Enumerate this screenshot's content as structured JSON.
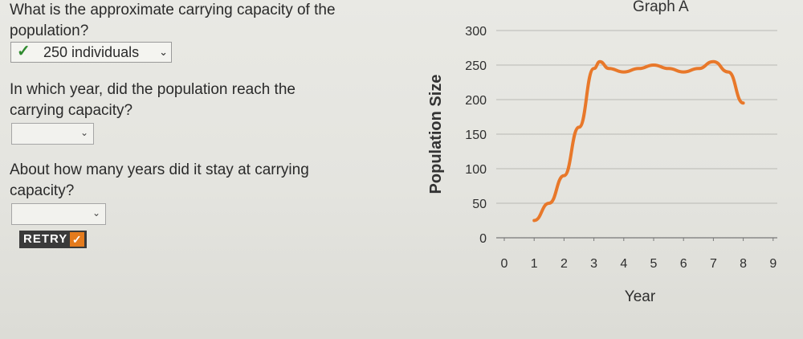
{
  "questions": {
    "q1": "What is the approximate carrying capacity of the population?",
    "q1_answer": "250 individuals",
    "q2": "In which year, did the population reach the carrying capacity?",
    "q3": "About how many years did it stay at carrying capacity?"
  },
  "retry_label": "RETRY",
  "icons": {
    "answer_check": "check-icon",
    "retry_check": "check-icon",
    "dropdown": "chevron-down-icon"
  },
  "colors": {
    "line": "#e8782a",
    "correct": "#2f8a2f",
    "retry_badge": "#e47b1d"
  },
  "chart_data": {
    "type": "line",
    "title": "Graph A",
    "xlabel": "Year",
    "ylabel": "Population Size",
    "x_ticks": [
      0,
      1,
      2,
      3,
      4,
      5,
      6,
      7,
      8,
      9
    ],
    "y_ticks": [
      0,
      50,
      100,
      150,
      200,
      250,
      300
    ],
    "xlim": [
      0,
      9
    ],
    "ylim": [
      0,
      300
    ],
    "grid": "horizontal",
    "series": [
      {
        "x": [
          1,
          1.5,
          2,
          2.5,
          3,
          3.2,
          3.5,
          4,
          4.5,
          5,
          5.5,
          6,
          6.5,
          7,
          7.5,
          8
        ],
        "y": [
          25,
          50,
          90,
          160,
          245,
          255,
          245,
          240,
          245,
          250,
          245,
          240,
          245,
          255,
          240,
          195
        ]
      }
    ]
  }
}
